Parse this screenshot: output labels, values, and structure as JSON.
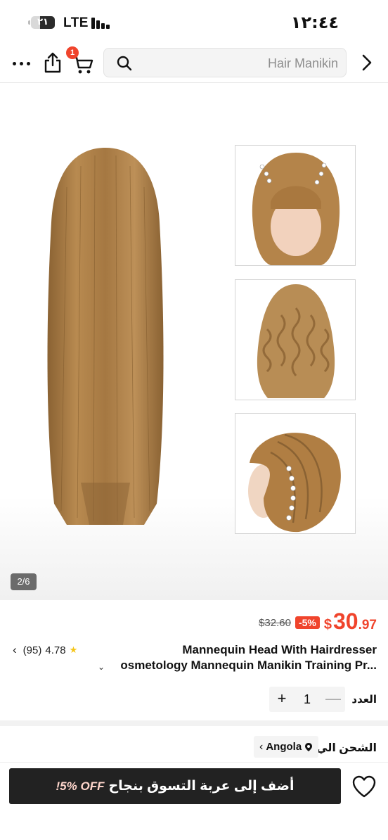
{
  "status_bar": {
    "battery": "٢١",
    "network": "LTE",
    "time": "١٢:٤٤"
  },
  "header": {
    "more_icon": "more-horizontal-icon",
    "share_icon": "share-icon",
    "cart_icon": "cart-icon",
    "cart_badge": "1",
    "search_icon": "search-icon",
    "search_text": "Hair Manikin",
    "forward_icon": "chevron-right-icon"
  },
  "gallery": {
    "counter": "2/6",
    "hair_color": "#a97d44"
  },
  "price": {
    "currency": "$",
    "integer": "30",
    "decimal": ".97",
    "discount": "-5%",
    "original": "$32.60"
  },
  "rating": {
    "score": "4.78",
    "count": "(95)"
  },
  "product": {
    "title_line1": "Mannequin Head With Hairdresser",
    "title_line2": "osmetology Mannequin Manikin Training Pr..."
  },
  "quantity": {
    "label": "العدد",
    "value": "1",
    "plus": "+",
    "minus": "—"
  },
  "shipping": {
    "label": "الشحن الي",
    "location": "Angola"
  },
  "bottom_bar": {
    "add_to_cart": "أضف إلى عربة التسوق بنجاح",
    "promo": "!5% OFF"
  },
  "colors": {
    "accent": "#f0442c",
    "button_bg": "#222222"
  }
}
